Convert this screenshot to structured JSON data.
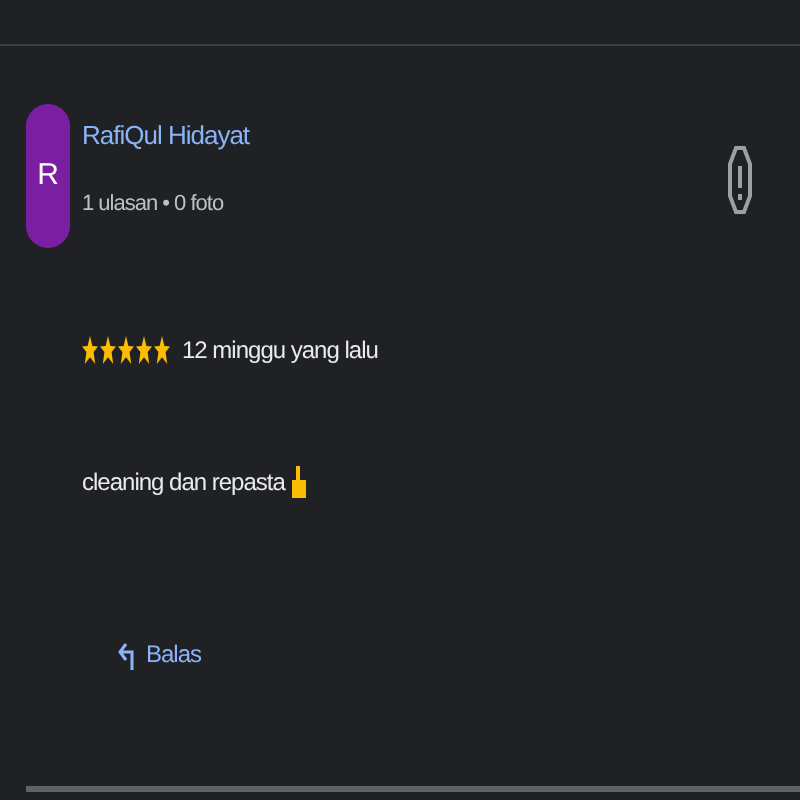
{
  "review": {
    "avatar_letter": "R",
    "author": "RafiQul Hidayat",
    "meta": "1 ulasan • 0 foto",
    "stars": 5,
    "time": "12 minggu yang lalu",
    "text": "cleaning dan repasta",
    "reply": "Balas"
  }
}
